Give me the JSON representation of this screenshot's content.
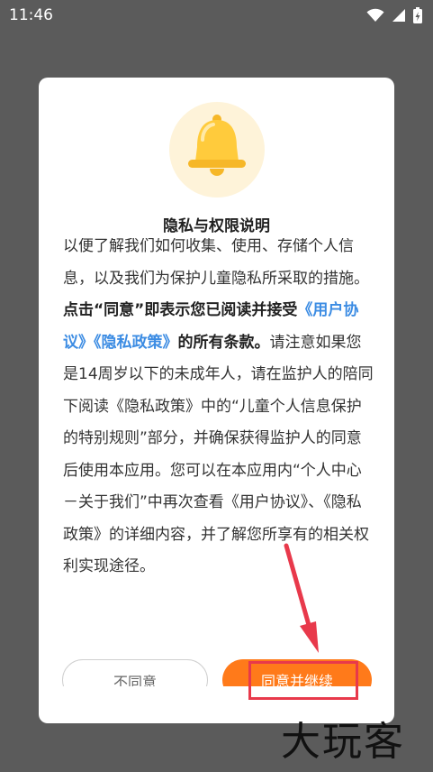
{
  "status_bar": {
    "time": "11:46",
    "icons": [
      "wifi-icon",
      "signal-icon",
      "battery-charging-icon"
    ]
  },
  "dialog": {
    "icon": "bell-icon",
    "title": "隐私与权限说明",
    "paragraph1_plain": "以便了解我们如何收集、使用、存储个人信息，以及我们为保护儿童隐私所采取的措施。",
    "paragraph1_bold": "点击“同意”即表示您已阅读并接受",
    "link_user_agreement": "《用户协议》",
    "link_privacy_policy": "《隐私政策》",
    "paragraph1_bold_end": "的所有条款。",
    "paragraph2": "请注意如果您是14周岁以下的未成年人，请在监护人的陪同下阅读《隐私政策》中的“儿童个人信息保护的特别规则”部分，并确保获得监护人的同意后使用本应用。您可以在本应用内“个人中心－关于我们”中再次查看《用户协议》、《隐私政策》的详细内容，并了解您所享有的相关权利实现途径。",
    "buttons": {
      "disagree": "不同意",
      "agree": "同意并继续"
    }
  },
  "watermark": "大玩客",
  "colors": {
    "accent_orange": "#ff7a1a",
    "link_blue": "#3c8ce3",
    "annotation_red": "#e8394b"
  }
}
